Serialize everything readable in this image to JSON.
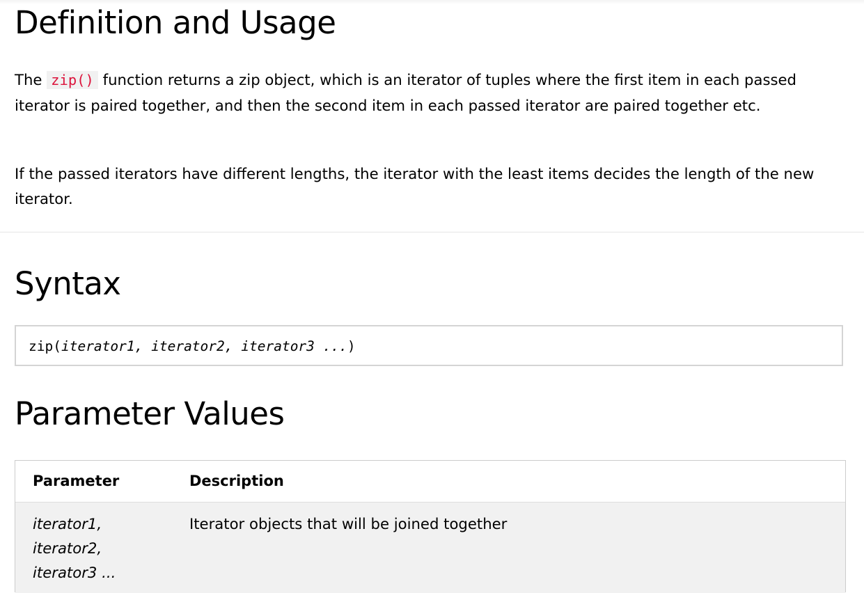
{
  "sections": {
    "definition": {
      "title": "Definition and Usage",
      "p1_before": "The",
      "p1_code": "zip()",
      "p1_after": "function returns a zip object, which is an iterator of tuples where the first item in each passed iterator is paired together, and then the second item in each passed iterator are paired together etc.",
      "p2": "If the passed iterators have different lengths, the iterator with the least items decides the length of the new iterator."
    },
    "syntax": {
      "title": "Syntax",
      "code_fn": "zip(",
      "code_args": "iterator1, iterator2, iterator3 ...",
      "code_close": ")"
    },
    "parameters": {
      "title": "Parameter Values",
      "headers": [
        "Parameter",
        "Description"
      ],
      "rows": [
        {
          "param_lines": [
            "iterator1,",
            "iterator2,",
            "iterator3 ..."
          ],
          "description": "Iterator objects that will be joined together"
        }
      ]
    }
  },
  "colors": {
    "inline_code_text": "#dc143c",
    "inline_code_bg": "#f1f1f1",
    "table_row_bg": "#f1f1f1",
    "border": "#cccccc"
  }
}
